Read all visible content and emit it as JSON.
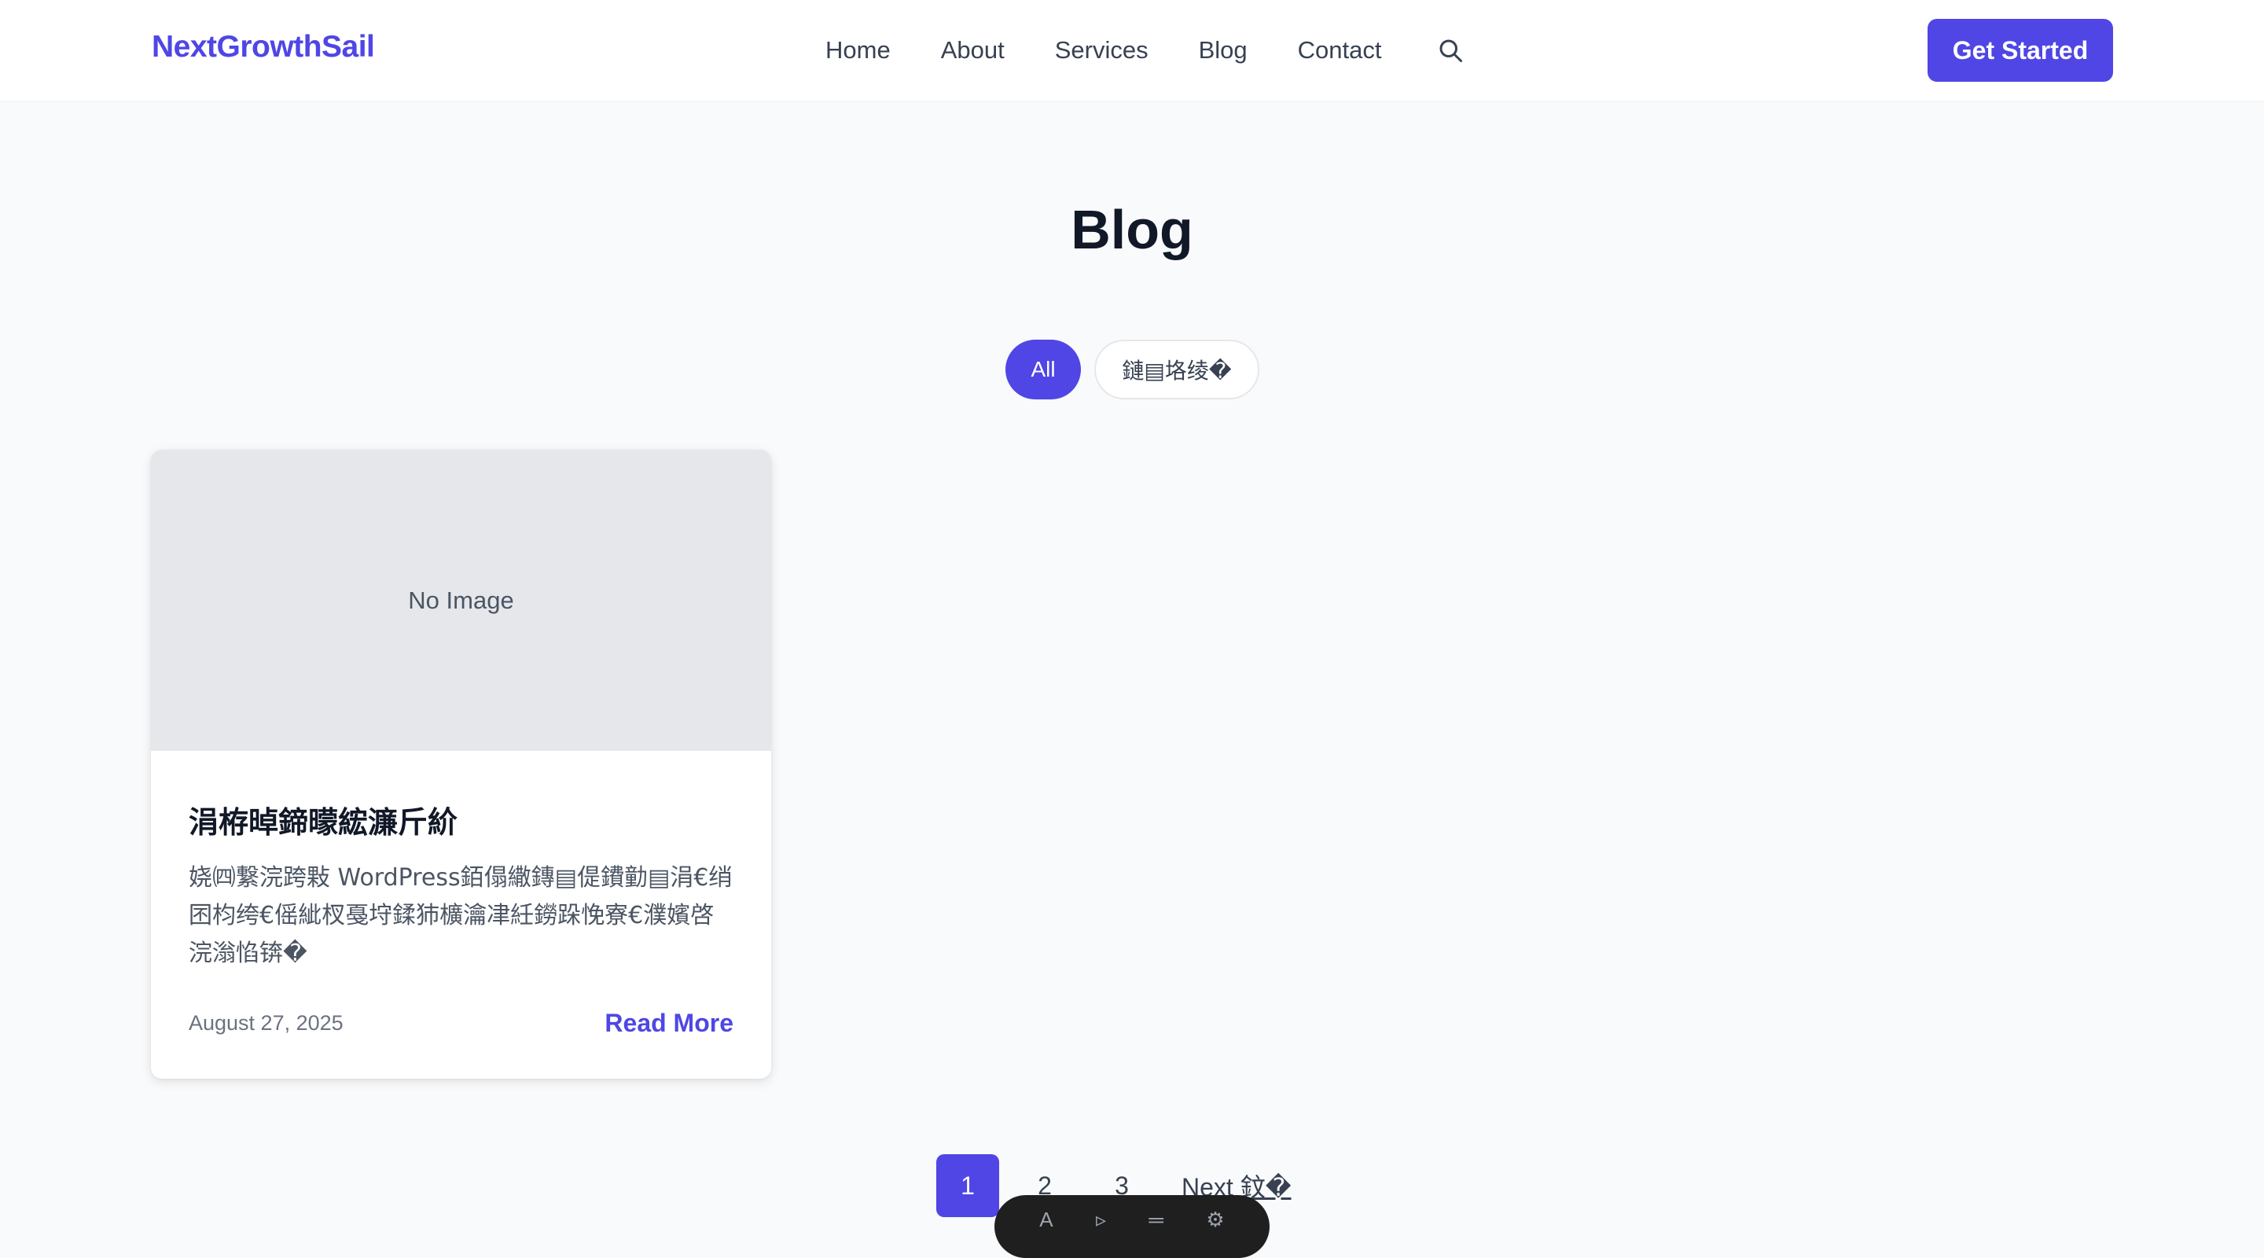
{
  "header": {
    "logo": "NextGrowthSail",
    "nav": [
      {
        "label": "Home"
      },
      {
        "label": "About"
      },
      {
        "label": "Services"
      },
      {
        "label": "Blog"
      },
      {
        "label": "Contact"
      }
    ],
    "search_icon": "search-icon",
    "cta_label": "Get Started"
  },
  "page": {
    "title": "Blog"
  },
  "filters": [
    {
      "label": "All",
      "active": true
    },
    {
      "label": "鏈▤垎绫�",
      "active": false
    }
  ],
  "posts": [
    {
      "image_placeholder": "No Image",
      "title": "涓栫晫鍗曚綋濂斤紒",
      "excerpt": "娆㈣繋浣跨敤 WordPress銆傝繖鏄▤偍鐨勭▤涓€绡囨枃绔€傜紪杈戞垨鍒犻櫎瀹冿紝鐒跺悗寮€濮嬪啓浣滃惂锛�",
      "date": "August 27, 2025",
      "read_more": "Read More"
    }
  ],
  "pagination": {
    "pages": [
      "1",
      "2",
      "3"
    ],
    "current": "1",
    "next_label": "Next 鈫�"
  },
  "floating_toolbar": {
    "items": [
      "A",
      "▹",
      "═",
      "⚙"
    ]
  },
  "colors": {
    "accent": "#4f46e5",
    "background": "#f9fafb",
    "card": "#ffffff",
    "image_placeholder": "#e5e7eb"
  }
}
